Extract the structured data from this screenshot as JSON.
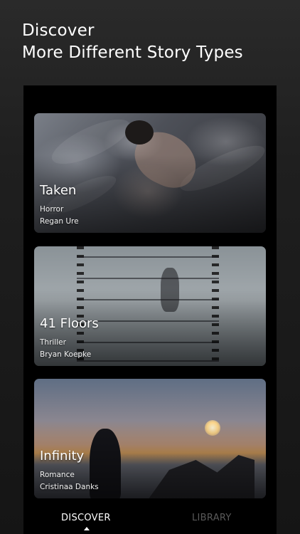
{
  "headline": {
    "line1": "Discover",
    "line2": "More Different Story Types"
  },
  "stories": [
    {
      "title": "Taken",
      "genre": "Horror",
      "author": "Regan Ure"
    },
    {
      "title": "41 Floors",
      "genre": "Thriller",
      "author": "Bryan Koepke"
    },
    {
      "title": "Infinity",
      "genre": "Romance",
      "author": "Cristinaa Danks"
    }
  ],
  "tabs": {
    "discover": "DISCOVER",
    "library": "LIBRARY",
    "active": "discover"
  },
  "colors": {
    "background": "#1c1c1c",
    "active_tab": "#ffffff",
    "inactive_tab": "#5a5a5a"
  }
}
